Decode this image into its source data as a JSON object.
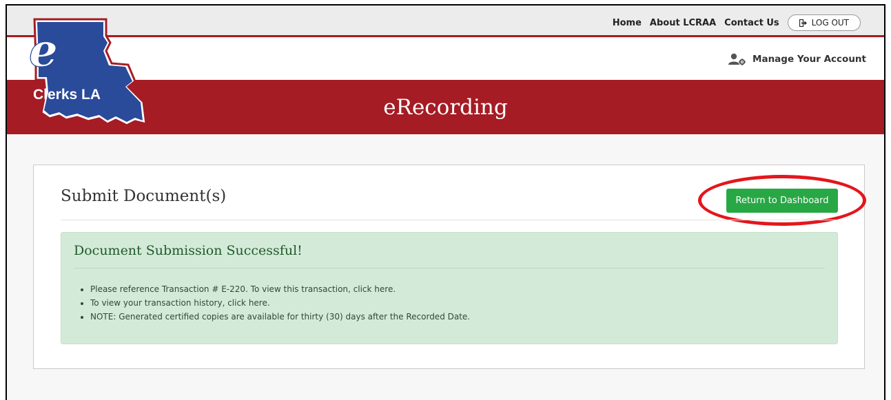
{
  "nav": {
    "home": "Home",
    "about": "About LCRAA",
    "contact": "Contact Us",
    "logout": "LOG OUT",
    "logout_icon": "sign-out-icon"
  },
  "account": {
    "manage_label": "Manage Your Account",
    "icon": "user-gear-icon"
  },
  "logo": {
    "letter": "e",
    "text": "Clerks LA"
  },
  "banner": {
    "title": "eRecording"
  },
  "page": {
    "title": "Submit Document(s)",
    "return_button": "Return to Dashboard"
  },
  "alert": {
    "title": "Document Submission Successful!",
    "items": [
      "Please reference Transaction # E-220. To view this transaction, click here.",
      "To view your transaction history, click here.",
      "NOTE: Generated certified copies are available for thirty (30) days after the Recorded Date."
    ]
  },
  "colors": {
    "brand_red": "#a51c24",
    "logo_blue": "#2a4a9a",
    "success_green": "#28a745",
    "alert_bg": "#d4ead8",
    "highlight_red": "#e4161c"
  }
}
